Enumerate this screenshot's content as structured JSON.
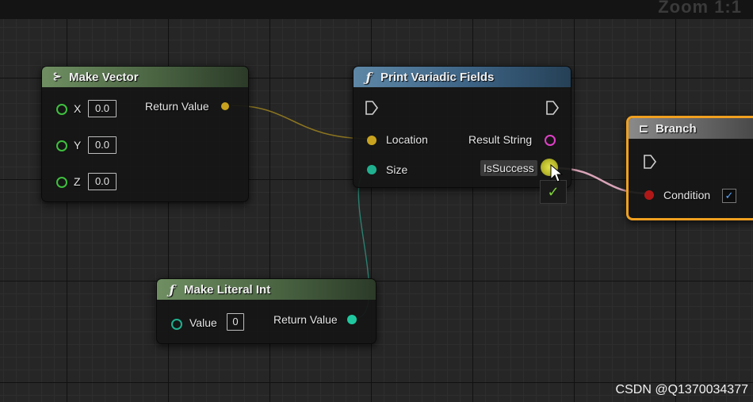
{
  "zoom_label": "Zoom 1:1",
  "nodes": {
    "make_vector": {
      "title": "Make Vector",
      "icon": "make-struct-icon",
      "inputs": [
        {
          "label": "X",
          "value": "0.0"
        },
        {
          "label": "Y",
          "value": "0.0"
        },
        {
          "label": "Z",
          "value": "0.0"
        }
      ],
      "output": "Return Value",
      "colors": {
        "header": "#5b7a50",
        "vector_pin": "#c9a31f",
        "float_pin": "#3fbf3f"
      }
    },
    "print_variadic": {
      "title": "Print Variadic Fields",
      "icon": "function-icon",
      "inputs": [
        {
          "label": "Location"
        },
        {
          "label": "Size"
        }
      ],
      "outputs": [
        {
          "label": "Result String"
        },
        {
          "label": "IsSuccess"
        }
      ],
      "colors": {
        "header": "#3c6283",
        "string_pin": "#e040c8",
        "int_pin": "#20b090"
      }
    },
    "branch": {
      "title": "Branch",
      "icon": "branch-icon",
      "condition_label": "Condition",
      "condition_checked": true,
      "colors": {
        "outline": "#f0a020",
        "bool_pin": "#b01818"
      }
    },
    "make_literal_int": {
      "title": "Make Literal Int",
      "icon": "function-icon",
      "input_label": "Value",
      "input_value": "0",
      "output": "Return Value",
      "colors": {
        "int_pin": "#20c8a0"
      }
    }
  },
  "watermark": "CSDN @Q1370034377"
}
